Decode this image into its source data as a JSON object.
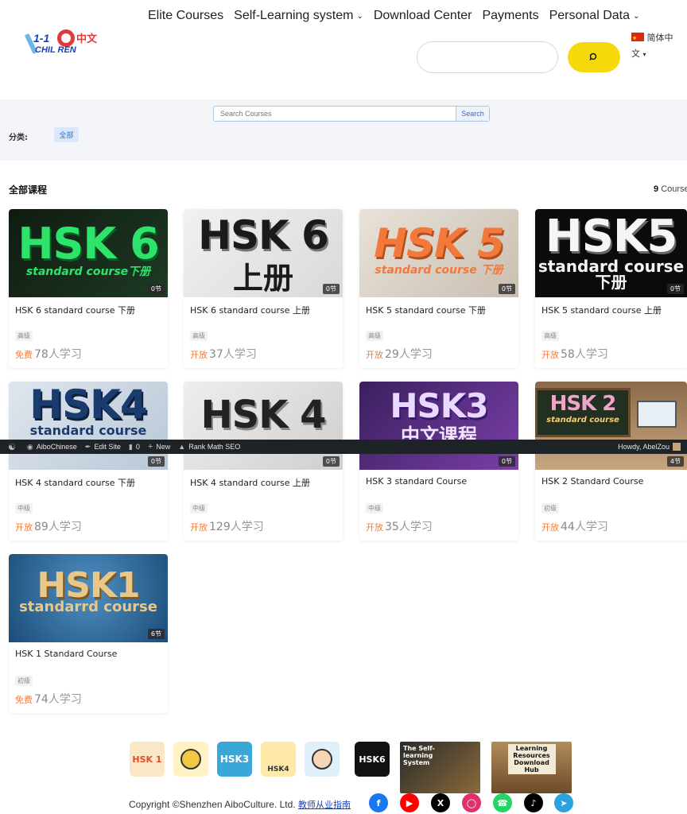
{
  "header": {
    "logo": {
      "num": "1-1",
      "zh": "中文",
      "en": "CHIL  REN"
    },
    "nav": [
      {
        "label": "Elite Courses",
        "has_menu": false
      },
      {
        "label": "Self-Learning system",
        "has_menu": true
      },
      {
        "label": "Download Center",
        "has_menu": false
      },
      {
        "label": "Payments",
        "has_menu": false
      },
      {
        "label": "Personal Data",
        "has_menu": true
      }
    ],
    "search_placeholder": "",
    "search_icon": "search-icon",
    "language": {
      "label_line1": "简体中",
      "label_line2": "文",
      "chevron": "▾"
    }
  },
  "filter": {
    "search_placeholder": "Search Courses",
    "search_button": "Search",
    "category_label": "分类:",
    "category_chip": "全部"
  },
  "section": {
    "title": "全部课程",
    "count": "9",
    "count_label": "Course"
  },
  "courses": [
    {
      "title": "HSK 6 standard course 下册",
      "level": "高级",
      "access": "免费",
      "learners": "78",
      "learners_suffix": "人学习",
      "lessons": "0节",
      "thumb_line1": "HSK 6",
      "thumb_line2": "standard course下册"
    },
    {
      "title": "HSK 6 standard course 上册",
      "level": "高级",
      "access": "开放",
      "learners": "37",
      "learners_suffix": "人学习",
      "lessons": "0节",
      "thumb_line1": "HSK 6",
      "thumb_line2": "上册"
    },
    {
      "title": "HSK 5 standard course 下册",
      "level": "高级",
      "access": "开放",
      "learners": "29",
      "learners_suffix": "人学习",
      "lessons": "0节",
      "thumb_line1": "HSK 5",
      "thumb_line2": "standard course 下册"
    },
    {
      "title": "HSK 5 standard course 上册",
      "level": "高级",
      "access": "开放",
      "learners": "58",
      "learners_suffix": "人学习",
      "lessons": "0节",
      "thumb_line1": "HSK5",
      "thumb_line2": "standard course 下册"
    },
    {
      "title": "HSK 4 standard course 下册",
      "level": "中级",
      "access": "开放",
      "learners": "89",
      "learners_suffix": "人学习",
      "lessons": "0节",
      "thumb_line1": "HSK4",
      "thumb_line2": "standard course"
    },
    {
      "title": "HSK 4 standard course 上册",
      "level": "中级",
      "access": "开放",
      "learners": "129",
      "learners_suffix": "人学习",
      "lessons": "0节",
      "thumb_line1": "HSK 4",
      "thumb_line2": ""
    },
    {
      "title": "HSK 3 standard Course",
      "level": "中级",
      "access": "开放",
      "learners": "35",
      "learners_suffix": "人学习",
      "lessons": "0节",
      "thumb_line1": "HSK3",
      "thumb_line2": "中文课程"
    },
    {
      "title": "HSK 2 Standard Course",
      "level": "初级",
      "access": "开放",
      "learners": "44",
      "learners_suffix": "人学习",
      "lessons": "4节",
      "thumb_line1": "HSK 2",
      "thumb_line2": "standard course"
    },
    {
      "title": "HSK 1 Standard Course",
      "level": "初级",
      "access": "免费",
      "learners": "74",
      "learners_suffix": "人学习",
      "lessons": "6节",
      "thumb_line1": "HSK1",
      "thumb_line2": "standarrd course"
    }
  ],
  "adminbar": {
    "site": "AiboChinese",
    "edit": "Edit Site",
    "comments": "0",
    "new": "New",
    "seo": "Rank Math SEO",
    "greeting": "Howdy, AbelZou"
  },
  "footer": {
    "icons": [
      {
        "name": "hsk1-icon",
        "text": "HSK 1"
      },
      {
        "name": "hsk2-icon",
        "text": ""
      },
      {
        "name": "hsk3-icon",
        "text": "HSK3"
      },
      {
        "name": "hsk4-icon",
        "text": "HSK4"
      },
      {
        "name": "hsk5-icon",
        "text": ""
      },
      {
        "name": "hsk6-icon",
        "text": "HSK6"
      }
    ],
    "self_learning_banner": "The Self-learning System",
    "resources_banner": "Learning Resources Download Hub",
    "copyright": "Copyright ©Shenzhen AiboCulture. Ltd.",
    "guide_link": "教师从业指南",
    "social": [
      "facebook-icon",
      "youtube-icon",
      "x-icon",
      "instagram-icon",
      "whatsapp-icon",
      "tiktok-icon",
      "telegram-icon"
    ]
  },
  "colors": {
    "accent_yellow": "#f5d90a",
    "link_blue": "#2a6fd0",
    "orange": "#f57c3a",
    "admin_bg": "#1d2327"
  }
}
